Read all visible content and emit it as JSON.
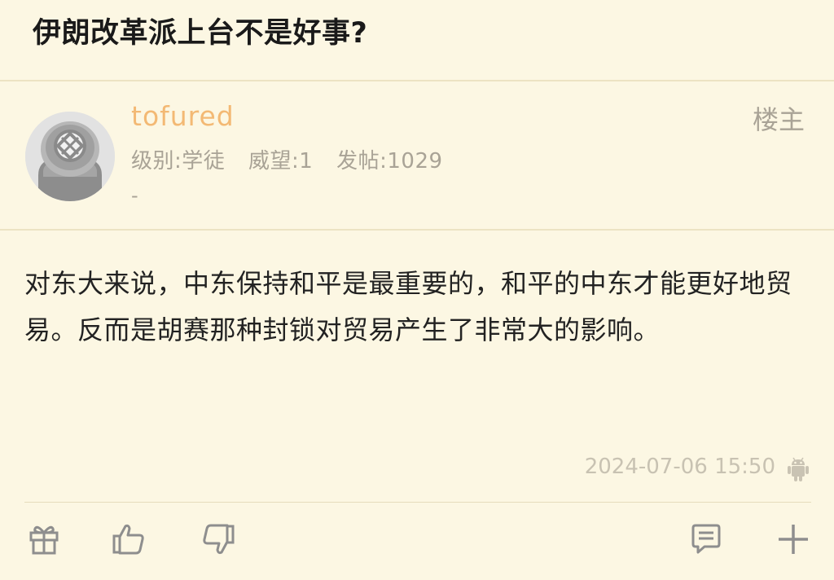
{
  "post": {
    "title": "伊朗改革派上台不是好事?",
    "author": {
      "username": "tofured",
      "level": "级别:学徒",
      "reputation": "威望:1",
      "posts": "发帖:1029",
      "signature": "-",
      "floor_tag": "楼主"
    },
    "content": "对东大来说，中东保持和平是最重要的，和平的中东才能更好地贸易。反而是胡赛那种封锁对贸易产生了非常大的影响。",
    "timestamp": "2024-07-06 15:50",
    "device_icon": "android-icon"
  },
  "actions": {
    "left": [
      "gift-icon",
      "like-icon",
      "dislike-icon"
    ],
    "right": [
      "comment-icon",
      "plus-icon"
    ]
  },
  "colors": {
    "background": "#fcf7e3",
    "username": "#f3b974",
    "meta": "#a9a396",
    "timestamp": "#c8c2b2"
  }
}
